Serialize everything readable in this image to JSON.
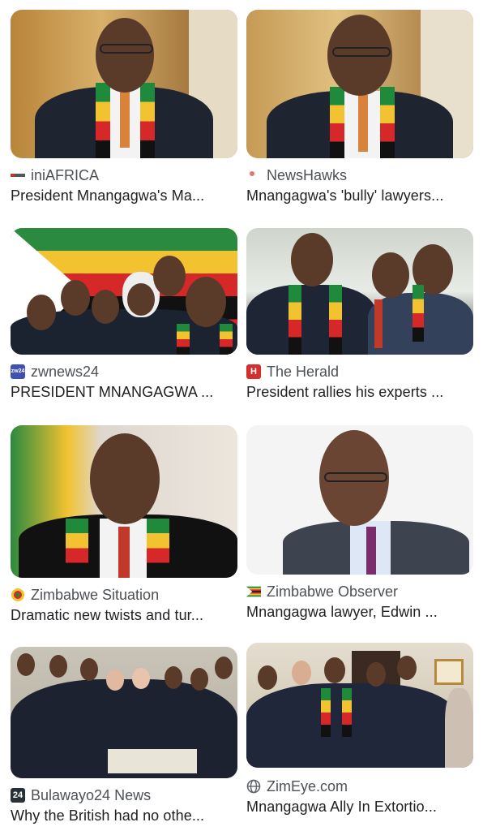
{
  "results": [
    {
      "source": "iniAFRICA",
      "title": "President Mnangagwa's Ma...",
      "favicon": "iniafrica-icon"
    },
    {
      "source": "NewsHawks",
      "title": "Mnangagwa's 'bully' lawyers...",
      "favicon": "newshawks-icon"
    },
    {
      "source": "zwnews24",
      "title": "PRESIDENT MNANGAGWA ...",
      "favicon": "zwnews24-icon"
    },
    {
      "source": "The Herald",
      "title": "President rallies his experts ...",
      "favicon": "herald-icon"
    },
    {
      "source": "Zimbabwe Situation",
      "title": "Dramatic new twists and tur...",
      "favicon": "zimbabwe-situation-icon"
    },
    {
      "source": "Zimbabwe Observer",
      "title": "Mnangagwa lawyer, Edwin ...",
      "favicon": "zimbabwe-flag-icon"
    },
    {
      "source": "Bulawayo24 News",
      "title": "Why the British had no othe...",
      "favicon": "bulawayo24-icon"
    },
    {
      "source": "ZimEye.com",
      "title": "Mnangagwa Ally In Extortio...",
      "favicon": "globe-icon"
    }
  ],
  "favicon_text": {
    "zwnews24": "zw24",
    "herald": "H",
    "bulawayo24": "24"
  }
}
